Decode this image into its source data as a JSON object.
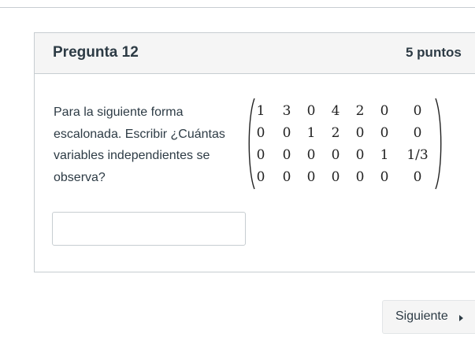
{
  "question": {
    "title": "Pregunta 12",
    "points": "5 puntos",
    "text": "Para la siguiente forma escalonada. Escribir ¿Cuántas variables independientes se observa?",
    "matrix": [
      [
        "1",
        "3",
        "0",
        "4",
        "2",
        "0",
        "0"
      ],
      [
        "0",
        "0",
        "1",
        "2",
        "0",
        "0",
        "0"
      ],
      [
        "0",
        "0",
        "0",
        "0",
        "0",
        "1",
        "1/3"
      ],
      [
        "0",
        "0",
        "0",
        "0",
        "0",
        "0",
        "0"
      ]
    ],
    "answer_value": "",
    "answer_placeholder": ""
  },
  "navigation": {
    "next_label": "Siguiente",
    "next_icon": "triangle-right-icon"
  }
}
